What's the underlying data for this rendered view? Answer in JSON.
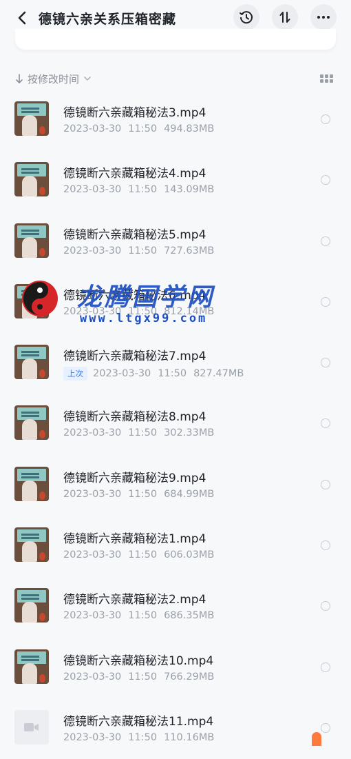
{
  "header": {
    "title": "德镜六亲关系压箱密藏",
    "back_icon": "chevron-left-icon",
    "history_icon": "history-clock-icon",
    "sort_icon": "sort-arrows-icon",
    "more_icon": "more-dots-icon"
  },
  "sortbar": {
    "label": "按修改时间",
    "arrow_icon": "arrow-down-icon",
    "dropdown_icon": "chevron-down-icon",
    "view_icon": "grid-view-icon"
  },
  "files": [
    {
      "name": "德镜断六亲藏箱秘法3.mp4",
      "date": "2023-03-30",
      "time": "11:50",
      "size": "494.83MB",
      "tag": ""
    },
    {
      "name": "德镜断六亲藏箱秘法4.mp4",
      "date": "2023-03-30",
      "time": "11:50",
      "size": "143.09MB",
      "tag": ""
    },
    {
      "name": "德镜断六亲藏箱秘法5.mp4",
      "date": "2023-03-30",
      "time": "11:50",
      "size": "727.63MB",
      "tag": ""
    },
    {
      "name": "德镜断六亲藏箱秘法6.mp4",
      "date": "2023-03-30",
      "time": "11:50",
      "size": "812.14MB",
      "tag": ""
    },
    {
      "name": "德镜断六亲藏箱秘法7.mp4",
      "date": "2023-03-30",
      "time": "11:50",
      "size": "827.47MB",
      "tag": "上次"
    },
    {
      "name": "德镜断六亲藏箱秘法8.mp4",
      "date": "2023-03-30",
      "time": "11:50",
      "size": "302.33MB",
      "tag": ""
    },
    {
      "name": "德镜断六亲藏箱秘法9.mp4",
      "date": "2023-03-30",
      "time": "11:50",
      "size": "684.99MB",
      "tag": ""
    },
    {
      "name": "德镜断六亲藏箱秘法1.mp4",
      "date": "2023-03-30",
      "time": "11:50",
      "size": "606.03MB",
      "tag": ""
    },
    {
      "name": "德镜断六亲藏箱秘法2.mp4",
      "date": "2023-03-30",
      "time": "11:50",
      "size": "686.35MB",
      "tag": ""
    },
    {
      "name": "德镜断六亲藏箱秘法10.mp4",
      "date": "2023-03-30",
      "time": "11:50",
      "size": "766.29MB",
      "tag": ""
    },
    {
      "name": "德镜断六亲藏箱秘法11.mp4",
      "date": "2023-03-30",
      "time": "11:50",
      "size": "110.16MB",
      "tag": ""
    }
  ],
  "watermark": {
    "text": "龙腾国学网",
    "url": "www.ltgx99.com"
  },
  "colors": {
    "accent": "#3d7be0",
    "watermark": "#1e4fc2",
    "fab": "#ff7a3d"
  }
}
